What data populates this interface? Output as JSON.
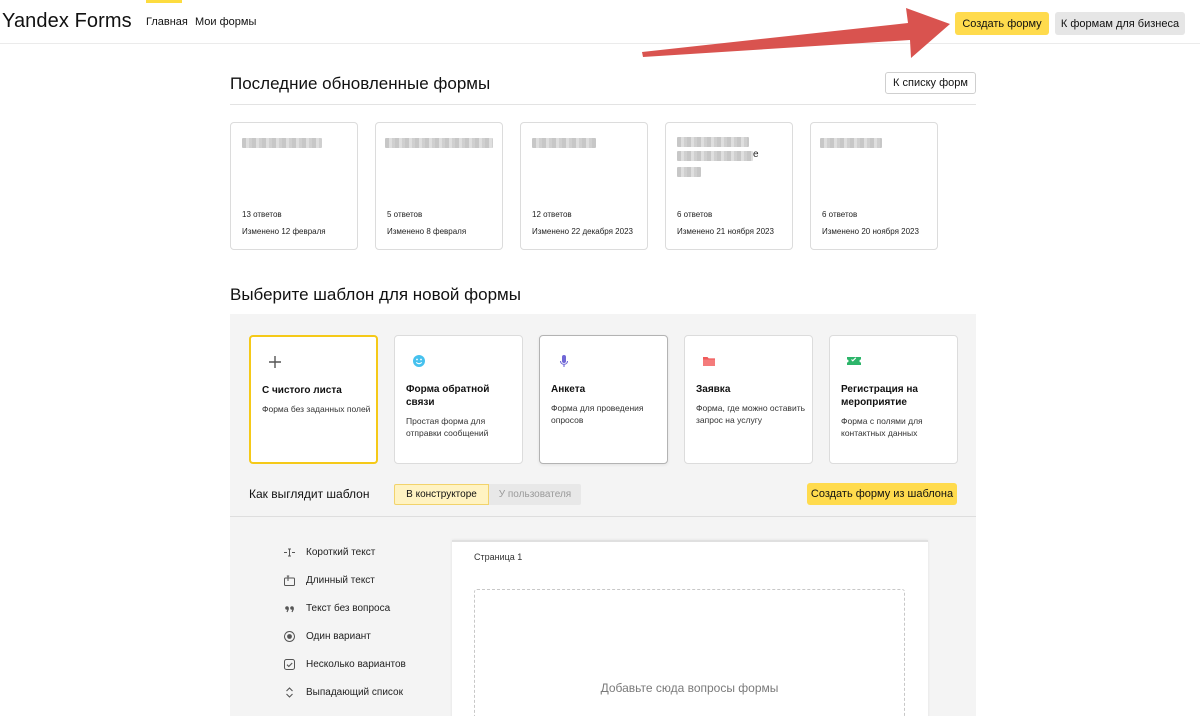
{
  "app": {
    "logo": "Yandex Forms"
  },
  "header": {
    "nav": [
      "Главная",
      "Мои формы"
    ],
    "create_form": "Создать форму",
    "business_forms": "К формам для бизнеса"
  },
  "recent": {
    "title": "Последние обновленные формы",
    "to_list": "К списку форм",
    "cards": [
      {
        "count": "13 ответов",
        "date": "Изменено 12 февраля"
      },
      {
        "count": "5 ответов",
        "date": "Изменено 8 февраля"
      },
      {
        "count": "12 ответов",
        "date": "Изменено 22 декабря 2023"
      },
      {
        "count": "6 ответов",
        "date": "Изменено 21 ноября 2023",
        "visible_char": "е"
      },
      {
        "count": "6 ответов",
        "date": "Изменено 20 ноября 2023"
      }
    ]
  },
  "templates": {
    "title": "Выберите шаблон для новой формы",
    "cards": [
      {
        "title": "С чистого листа",
        "desc": "Форма без заданных полей",
        "icon": "plus-icon",
        "icon_bg": "#e6e6e6"
      },
      {
        "title": "Форма обратной связи",
        "desc": "Простая форма для отправки сообщений",
        "icon": "smiley-icon",
        "icon_bg": "#d6f1fb"
      },
      {
        "title": "Анкета",
        "desc": "Форма для проведения опросов",
        "icon": "microphone-icon",
        "icon_bg": "#e3e2f7"
      },
      {
        "title": "Заявка",
        "desc": "Форма, где можно оставить запрос на услугу",
        "icon": "folder-icon",
        "icon_bg": "#fde0e0"
      },
      {
        "title": "Регистрация на мероприятие",
        "desc": "Форма с полями для контактных данных",
        "icon": "ticket-icon",
        "icon_bg": "#d8f3e2"
      }
    ],
    "preview_label": "Как выглядит шаблон",
    "view_constructor": "В конструкторе",
    "view_user": "У пользователя",
    "create_from_template": "Создать форму из шаблона"
  },
  "questions": [
    {
      "label": "Короткий текст",
      "icon": "short-text-icon"
    },
    {
      "label": "Длинный текст",
      "icon": "long-text-icon"
    },
    {
      "label": "Текст без вопроса",
      "icon": "quote-icon"
    },
    {
      "label": "Один вариант",
      "icon": "radio-icon"
    },
    {
      "label": "Несколько вариантов",
      "icon": "checkbox-icon"
    },
    {
      "label": "Выпадающий список",
      "icon": "dropdown-icon"
    }
  ],
  "canvas": {
    "page_label": "Страница 1",
    "drop_hint": "Добавьте сюда вопросы формы"
  },
  "colors": {
    "accent_yellow": "#ffdb4d",
    "selected_border": "#f5c918",
    "annotation_arrow": "#d9534f"
  }
}
